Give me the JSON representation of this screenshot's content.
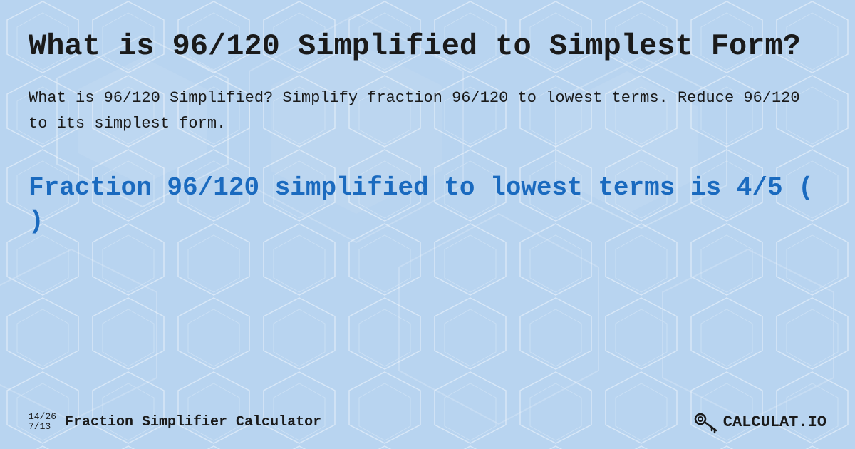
{
  "background": {
    "color": "#c8dff5"
  },
  "main_title": "What is 96/120 Simplified to Simplest Form?",
  "description": "What is 96/120 Simplified? Simplify fraction 96/120 to lowest terms. Reduce 96/120 to its simplest form.",
  "result": {
    "text": "Fraction 96/120 simplified to lowest terms is 4/5 ( )"
  },
  "footer": {
    "fraction_top": "14/26",
    "fraction_bottom": "7/13",
    "title": "Fraction Simplifier Calculator",
    "logo": "CALCULAT.IO"
  }
}
